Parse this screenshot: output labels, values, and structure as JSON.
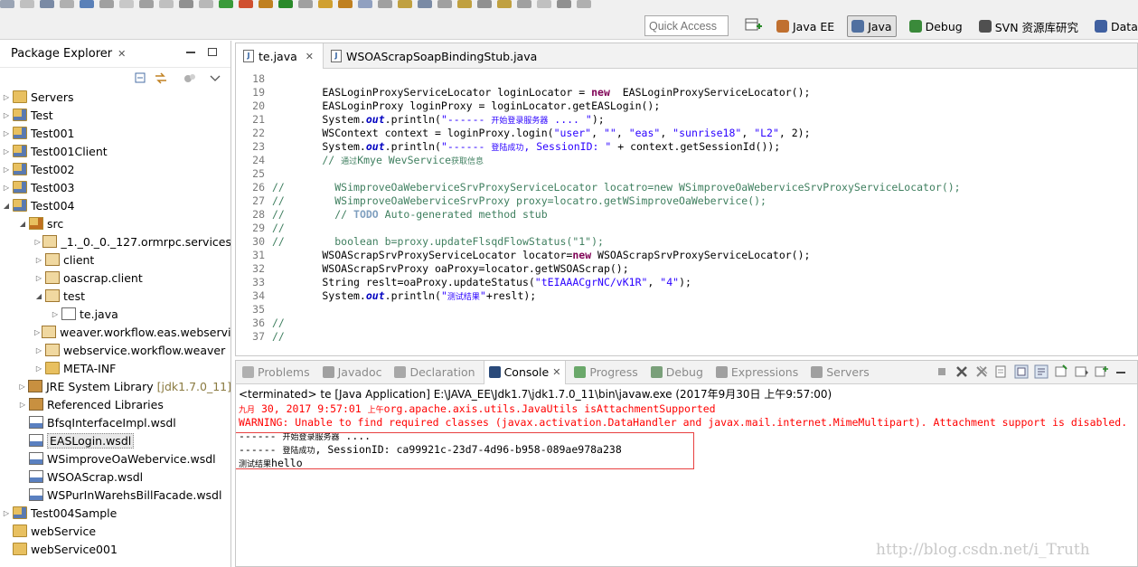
{
  "toolbar": {
    "quick_access_placeholder": "Quick Access",
    "perspectives": [
      {
        "label": "Java EE",
        "icon": "java-ee-icon",
        "active": false
      },
      {
        "label": "Java",
        "icon": "java-perspective-icon",
        "active": true
      },
      {
        "label": "Debug",
        "icon": "bug-icon",
        "active": false
      },
      {
        "label": "SVN 资源库研究",
        "icon": "svn-icon",
        "active": false
      },
      {
        "label": "Database I",
        "icon": "database-icon",
        "active": false
      }
    ]
  },
  "explorer": {
    "title": "Package Explorer",
    "close": "✕",
    "tree": [
      {
        "label": "Servers",
        "level": 0,
        "twisty": "▷",
        "icon": "folder-icon"
      },
      {
        "label": "Test",
        "level": 0,
        "twisty": "▷",
        "icon": "project-icon"
      },
      {
        "label": "Test001",
        "level": 0,
        "twisty": "▷",
        "icon": "project-icon"
      },
      {
        "label": "Test001Client",
        "level": 0,
        "twisty": "▷",
        "icon": "project-icon"
      },
      {
        "label": "Test002",
        "level": 0,
        "twisty": "▷",
        "icon": "project-icon"
      },
      {
        "label": "Test003",
        "level": 0,
        "twisty": "▷",
        "icon": "project-icon"
      },
      {
        "label": "Test004",
        "level": 0,
        "twisty": "◢",
        "icon": "project-icon"
      },
      {
        "label": "src",
        "level": 1,
        "twisty": "◢",
        "icon": "source-folder-icon"
      },
      {
        "label": "_1._0._0._127.ormrpc.services",
        "level": 2,
        "twisty": "▷",
        "icon": "package-icon"
      },
      {
        "label": "client",
        "level": 2,
        "twisty": "▷",
        "icon": "package-icon"
      },
      {
        "label": "oascrap.client",
        "level": 2,
        "twisty": "▷",
        "icon": "package-icon"
      },
      {
        "label": "test",
        "level": 2,
        "twisty": "◢",
        "icon": "package-icon"
      },
      {
        "label": "te.java",
        "level": 3,
        "twisty": "▷",
        "icon": "java-file-icon"
      },
      {
        "label": "weaver.workflow.eas.webservic",
        "level": 2,
        "twisty": "▷",
        "icon": "package-icon"
      },
      {
        "label": "webservice.workflow.weaver",
        "level": 2,
        "twisty": "▷",
        "icon": "package-icon"
      },
      {
        "label": "META-INF",
        "level": 2,
        "twisty": "▷",
        "icon": "folder-icon"
      },
      {
        "label": "JRE System Library",
        "suffix": "[jdk1.7.0_11]",
        "level": 1,
        "twisty": "▷",
        "icon": "library-icon"
      },
      {
        "label": "Referenced Libraries",
        "level": 1,
        "twisty": "▷",
        "icon": "library-icon"
      },
      {
        "label": "BfsqInterfaceImpl.wsdl",
        "level": 1,
        "twisty": "",
        "icon": "wsdl-icon"
      },
      {
        "label": "EASLogin.wsdl",
        "level": 1,
        "twisty": "",
        "icon": "wsdl-icon",
        "selected": true
      },
      {
        "label": "WSimproveOaWebervice.wsdl",
        "level": 1,
        "twisty": "",
        "icon": "wsdl-icon"
      },
      {
        "label": "WSOAScrap.wsdl",
        "level": 1,
        "twisty": "",
        "icon": "wsdl-icon"
      },
      {
        "label": "WSPurInWarehsBillFacade.wsdl",
        "level": 1,
        "twisty": "",
        "icon": "wsdl-icon"
      },
      {
        "label": "Test004Sample",
        "level": 0,
        "twisty": "▷",
        "icon": "project-icon"
      },
      {
        "label": "webService",
        "level": 0,
        "twisty": "",
        "icon": "folder-icon"
      },
      {
        "label": "webService001",
        "level": 0,
        "twisty": "",
        "icon": "folder-icon"
      }
    ]
  },
  "editor": {
    "tabs": [
      {
        "label": "te.java",
        "active": true,
        "close": "✕"
      },
      {
        "label": "WSOAScrapSoapBindingStub.java",
        "active": false
      }
    ],
    "lines": [
      {
        "n": "18",
        "parts": []
      },
      {
        "n": "19",
        "parts": [
          [
            "",
            "        EASLoginProxyServiceLocator loginLocator = "
          ],
          [
            "kw",
            "new"
          ],
          [
            "",
            "  EASLoginProxyServiceLocator();"
          ]
        ]
      },
      {
        "n": "20",
        "parts": [
          [
            "",
            "        EASLoginProxy loginProxy = loginLocator.getEASLogin();"
          ]
        ]
      },
      {
        "n": "21",
        "parts": [
          [
            "",
            "        System."
          ],
          [
            "fi",
            "out"
          ],
          [
            "",
            ".println("
          ],
          [
            "st",
            "\"------ "
          ],
          [
            "st cn",
            "开始登录服务器"
          ],
          [
            "st",
            " .... \""
          ],
          [
            "",
            ");"
          ]
        ]
      },
      {
        "n": "22",
        "parts": [
          [
            "",
            "        WSContext context = loginProxy.login("
          ],
          [
            "st",
            "\"user\""
          ],
          [
            "",
            ", "
          ],
          [
            "st",
            "\"\""
          ],
          [
            "",
            ", "
          ],
          [
            "st",
            "\"eas\""
          ],
          [
            "",
            ", "
          ],
          [
            "st",
            "\"sunrise18\""
          ],
          [
            "",
            ", "
          ],
          [
            "st",
            "\"L2\""
          ],
          [
            "",
            ", 2);"
          ]
        ]
      },
      {
        "n": "23",
        "parts": [
          [
            "",
            "        System."
          ],
          [
            "fi",
            "out"
          ],
          [
            "",
            ".println("
          ],
          [
            "st",
            "\"------ "
          ],
          [
            "st cn",
            "登陆成功"
          ],
          [
            "st",
            ", SessionID: \""
          ],
          [
            "",
            " + context.getSessionId());"
          ]
        ]
      },
      {
        "n": "24",
        "parts": [
          [
            "cm",
            "        // "
          ],
          [
            "cm cn",
            "通过"
          ],
          [
            "cm",
            "Kmye WevService"
          ],
          [
            "cm cn",
            "获取信息"
          ]
        ]
      },
      {
        "n": "25",
        "parts": []
      },
      {
        "n": "26",
        "parts": [
          [
            "cm",
            "//        WSimproveOaWeberviceSrvProxyServiceLocator locatro=new WSimproveOaWeberviceSrvProxyServiceLocator();"
          ]
        ]
      },
      {
        "n": "27",
        "parts": [
          [
            "cm",
            "//        WSimproveOaWeberviceSrvProxy proxy=locatro.getWSimproveOaWebervice();"
          ]
        ]
      },
      {
        "n": "28",
        "parts": [
          [
            "cm",
            "//        // "
          ],
          [
            "tag",
            "TODO"
          ],
          [
            "cm",
            " Auto-generated method stub"
          ]
        ]
      },
      {
        "n": "29",
        "parts": [
          [
            "cm",
            "//"
          ]
        ]
      },
      {
        "n": "30",
        "parts": [
          [
            "cm",
            "//        boolean b=proxy.updateFlsqdFlowStatus(\"1\");"
          ]
        ]
      },
      {
        "n": "31",
        "parts": [
          [
            "",
            "        WSOAScrapSrvProxyServiceLocator locator="
          ],
          [
            "kw",
            "new"
          ],
          [
            "",
            " WSOAScrapSrvProxyServiceLocator();"
          ]
        ]
      },
      {
        "n": "32",
        "parts": [
          [
            "",
            "        WSOAScrapSrvProxy oaProxy=locator.getWSOAScrap();"
          ]
        ]
      },
      {
        "n": "33",
        "parts": [
          [
            "",
            "        String reslt=oaProxy.updateStatus("
          ],
          [
            "st",
            "\"tEIAAACgrNC/vK1R\""
          ],
          [
            "",
            ", "
          ],
          [
            "st",
            "\"4\""
          ],
          [
            "",
            ");"
          ]
        ]
      },
      {
        "n": "34",
        "parts": [
          [
            "",
            "        System."
          ],
          [
            "fi",
            "out"
          ],
          [
            "",
            ".println("
          ],
          [
            "st",
            "\""
          ],
          [
            "st cn",
            "测试结果"
          ],
          [
            "st",
            "\""
          ],
          [
            "",
            "+reslt);"
          ]
        ]
      },
      {
        "n": "35",
        "parts": []
      },
      {
        "n": "36",
        "parts": [
          [
            "cm",
            "//"
          ]
        ]
      },
      {
        "n": "37",
        "parts": [
          [
            "cm",
            "//"
          ]
        ]
      }
    ]
  },
  "console": {
    "tabs": [
      {
        "label": "Problems",
        "icon": "problems-icon",
        "active": false
      },
      {
        "label": "Javadoc",
        "icon": "javadoc-icon",
        "active": false
      },
      {
        "label": "Declaration",
        "icon": "declaration-icon",
        "active": false
      },
      {
        "label": "Console",
        "icon": "console-icon",
        "active": true,
        "close": "✕"
      },
      {
        "label": "Progress",
        "icon": "progress-icon",
        "active": false
      },
      {
        "label": "Debug",
        "icon": "bug-icon",
        "active": false
      },
      {
        "label": "Expressions",
        "icon": "expressions-icon",
        "active": false
      },
      {
        "label": "Servers",
        "icon": "servers-icon",
        "active": false
      }
    ],
    "terminated_line": "<terminated> te [Java Application] E:\\JAVA_EE\\Jdk1.7\\jdk1.7.0_11\\bin\\javaw.exe (2017年9月30日 上午9:57:00)",
    "output": [
      {
        "style": "err",
        "parts": [
          [
            "cn",
            "九月"
          ],
          [
            "",
            " 30, 2017 9:57:01 "
          ],
          [
            "cn",
            "上午"
          ],
          [
            "",
            "org.apache.axis.utils.JavaUtils isAttachmentSupported"
          ]
        ]
      },
      {
        "style": "err",
        "parts": [
          [
            "",
            "WARNING: Unable to find required classes (javax.activation.DataHandler and javax.mail.internet.MimeMultipart). Attachment support is disabled."
          ]
        ]
      },
      {
        "style": "out",
        "parts": [
          [
            "",
            "------ "
          ],
          [
            "cn",
            "开始登录服务器"
          ],
          [
            "",
            " ...."
          ]
        ]
      },
      {
        "style": "out",
        "parts": [
          [
            "",
            "------ "
          ],
          [
            "cn",
            "登陆成功"
          ],
          [
            "",
            ", SessionID: ca99921c-23d7-4d96-b958-089ae978a238"
          ]
        ]
      },
      {
        "style": "out",
        "parts": [
          [
            "cn",
            "测试结果"
          ],
          [
            "",
            "hello"
          ]
        ]
      }
    ],
    "watermark": "http://blog.csdn.net/i_Truth"
  }
}
